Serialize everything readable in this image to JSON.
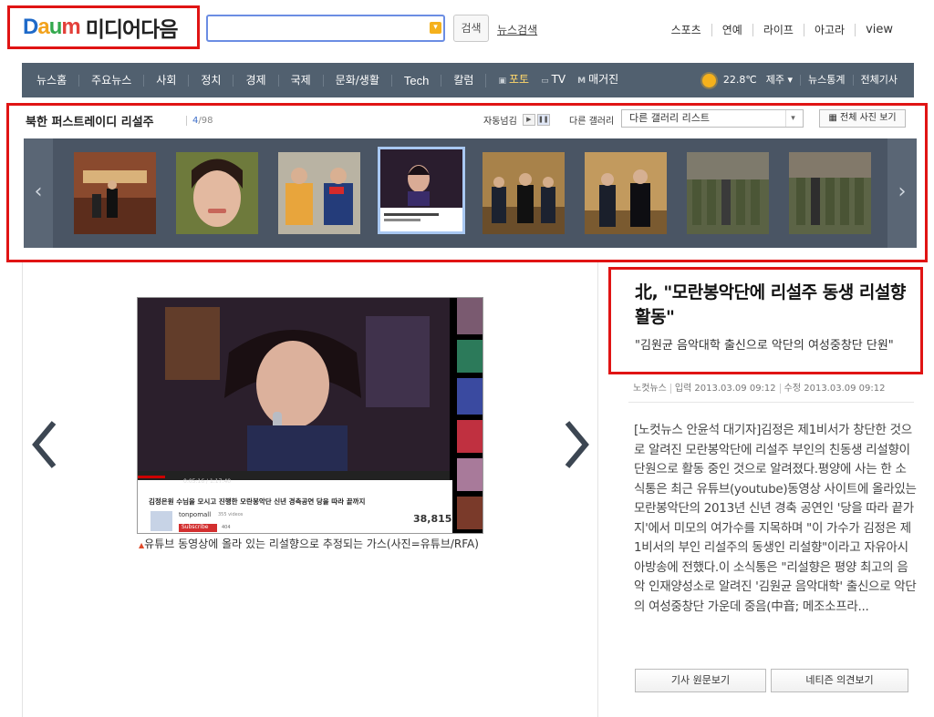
{
  "logo": {
    "d": "D",
    "a": "a",
    "u": "u",
    "m": "m",
    "title": "미디어다음"
  },
  "search": {
    "button_label": "검색",
    "news_search": "뉴스검색",
    "dropdown_icon": "chevron-down-icon"
  },
  "top_nav": [
    "스포츠",
    "연예",
    "라이프",
    "아고라",
    "view"
  ],
  "navbar": {
    "items": [
      "뉴스홈",
      "주요뉴스",
      "사회",
      "정치",
      "경제",
      "국제",
      "문화/생활",
      "Tech",
      "칼럼"
    ],
    "photo": "포토",
    "tv": "TV",
    "magazine": "매거진",
    "weather": {
      "temp": "22.8℃",
      "city": "제주",
      "icon": "sun-icon"
    },
    "right_items": [
      "뉴스통계",
      "전체기사"
    ]
  },
  "gallery": {
    "title": "북한 퍼스트레이디 리설주",
    "current": "4",
    "total": "/98",
    "autoplay_label": "자동넘김",
    "other_label": "다른 갤러리",
    "select_value": "다른 갤러리 리스트",
    "all_photos": "전체 사진 보기",
    "active_index": 3,
    "thumb_count": 9
  },
  "main_image": {
    "caption": "유튜브 동영상에 올라 있는 리설향으로 추정되는 가스(사진=유튜브/RFA)",
    "video_title": "김정은원 수님을 모시고 진행한 모란봉악단 신년 경축공연 당을 따라 끝까지",
    "channel": "tonpomall",
    "views": "38,815",
    "subscribe": "Subscribe",
    "time": "0:05:16 / 1:17:40",
    "subs_count": "404",
    "videos": "355 videos"
  },
  "article": {
    "headline": "北, \"모란봉악단에 리설주 동생 리설향 활동\"",
    "subhead": "\"김원균 음악대학 출신으로 악단의 여성중창단 단원\"",
    "source": "노컷뉴스",
    "input_date": "입력 2013.03.09 09:12",
    "modified_date": "수정 2013.03.09 09:12",
    "body": "[노컷뉴스 안윤석 대기자]김정은 제1비서가 창단한 것으로 알려진 모란봉악단에 리설주 부인의 친동생 리설향이 단원으로 활동 중인 것으로 알려졌다.평양에 사는 한 소식통은 최근 유튜브(youtube)동영상 사이트에 올라있는 모란봉악단의 2013년 신년 경축 공연인 '당을 따라 끝가지'에서 미모의 여가수를 지목하며 \"이 가수가 김정은 제1비서의 부인 리설주의 동생인 리설향\"이라고 자유아시아방송에 전했다.이 소식통은 \"리설향은 평양 최고의 음악 인재양성소로 알려진 '김원균 음악대학' 출신으로 악단의 여성중창단 가운데 중음(中音; 메조소프라...",
    "btn_original": "기사 원문보기",
    "btn_opinion": "네티즌 의견보기"
  }
}
